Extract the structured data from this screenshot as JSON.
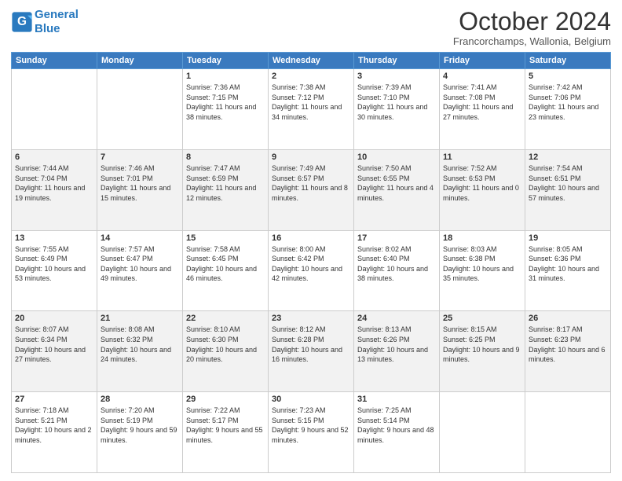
{
  "header": {
    "logo_line1": "General",
    "logo_line2": "Blue",
    "month": "October 2024",
    "location": "Francorchamps, Wallonia, Belgium"
  },
  "days_of_week": [
    "Sunday",
    "Monday",
    "Tuesday",
    "Wednesday",
    "Thursday",
    "Friday",
    "Saturday"
  ],
  "weeks": [
    [
      {
        "num": "",
        "detail": ""
      },
      {
        "num": "",
        "detail": ""
      },
      {
        "num": "1",
        "detail": "Sunrise: 7:36 AM\nSunset: 7:15 PM\nDaylight: 11 hours and 38 minutes."
      },
      {
        "num": "2",
        "detail": "Sunrise: 7:38 AM\nSunset: 7:12 PM\nDaylight: 11 hours and 34 minutes."
      },
      {
        "num": "3",
        "detail": "Sunrise: 7:39 AM\nSunset: 7:10 PM\nDaylight: 11 hours and 30 minutes."
      },
      {
        "num": "4",
        "detail": "Sunrise: 7:41 AM\nSunset: 7:08 PM\nDaylight: 11 hours and 27 minutes."
      },
      {
        "num": "5",
        "detail": "Sunrise: 7:42 AM\nSunset: 7:06 PM\nDaylight: 11 hours and 23 minutes."
      }
    ],
    [
      {
        "num": "6",
        "detail": "Sunrise: 7:44 AM\nSunset: 7:04 PM\nDaylight: 11 hours and 19 minutes."
      },
      {
        "num": "7",
        "detail": "Sunrise: 7:46 AM\nSunset: 7:01 PM\nDaylight: 11 hours and 15 minutes."
      },
      {
        "num": "8",
        "detail": "Sunrise: 7:47 AM\nSunset: 6:59 PM\nDaylight: 11 hours and 12 minutes."
      },
      {
        "num": "9",
        "detail": "Sunrise: 7:49 AM\nSunset: 6:57 PM\nDaylight: 11 hours and 8 minutes."
      },
      {
        "num": "10",
        "detail": "Sunrise: 7:50 AM\nSunset: 6:55 PM\nDaylight: 11 hours and 4 minutes."
      },
      {
        "num": "11",
        "detail": "Sunrise: 7:52 AM\nSunset: 6:53 PM\nDaylight: 11 hours and 0 minutes."
      },
      {
        "num": "12",
        "detail": "Sunrise: 7:54 AM\nSunset: 6:51 PM\nDaylight: 10 hours and 57 minutes."
      }
    ],
    [
      {
        "num": "13",
        "detail": "Sunrise: 7:55 AM\nSunset: 6:49 PM\nDaylight: 10 hours and 53 minutes."
      },
      {
        "num": "14",
        "detail": "Sunrise: 7:57 AM\nSunset: 6:47 PM\nDaylight: 10 hours and 49 minutes."
      },
      {
        "num": "15",
        "detail": "Sunrise: 7:58 AM\nSunset: 6:45 PM\nDaylight: 10 hours and 46 minutes."
      },
      {
        "num": "16",
        "detail": "Sunrise: 8:00 AM\nSunset: 6:42 PM\nDaylight: 10 hours and 42 minutes."
      },
      {
        "num": "17",
        "detail": "Sunrise: 8:02 AM\nSunset: 6:40 PM\nDaylight: 10 hours and 38 minutes."
      },
      {
        "num": "18",
        "detail": "Sunrise: 8:03 AM\nSunset: 6:38 PM\nDaylight: 10 hours and 35 minutes."
      },
      {
        "num": "19",
        "detail": "Sunrise: 8:05 AM\nSunset: 6:36 PM\nDaylight: 10 hours and 31 minutes."
      }
    ],
    [
      {
        "num": "20",
        "detail": "Sunrise: 8:07 AM\nSunset: 6:34 PM\nDaylight: 10 hours and 27 minutes."
      },
      {
        "num": "21",
        "detail": "Sunrise: 8:08 AM\nSunset: 6:32 PM\nDaylight: 10 hours and 24 minutes."
      },
      {
        "num": "22",
        "detail": "Sunrise: 8:10 AM\nSunset: 6:30 PM\nDaylight: 10 hours and 20 minutes."
      },
      {
        "num": "23",
        "detail": "Sunrise: 8:12 AM\nSunset: 6:28 PM\nDaylight: 10 hours and 16 minutes."
      },
      {
        "num": "24",
        "detail": "Sunrise: 8:13 AM\nSunset: 6:26 PM\nDaylight: 10 hours and 13 minutes."
      },
      {
        "num": "25",
        "detail": "Sunrise: 8:15 AM\nSunset: 6:25 PM\nDaylight: 10 hours and 9 minutes."
      },
      {
        "num": "26",
        "detail": "Sunrise: 8:17 AM\nSunset: 6:23 PM\nDaylight: 10 hours and 6 minutes."
      }
    ],
    [
      {
        "num": "27",
        "detail": "Sunrise: 7:18 AM\nSunset: 5:21 PM\nDaylight: 10 hours and 2 minutes."
      },
      {
        "num": "28",
        "detail": "Sunrise: 7:20 AM\nSunset: 5:19 PM\nDaylight: 9 hours and 59 minutes."
      },
      {
        "num": "29",
        "detail": "Sunrise: 7:22 AM\nSunset: 5:17 PM\nDaylight: 9 hours and 55 minutes."
      },
      {
        "num": "30",
        "detail": "Sunrise: 7:23 AM\nSunset: 5:15 PM\nDaylight: 9 hours and 52 minutes."
      },
      {
        "num": "31",
        "detail": "Sunrise: 7:25 AM\nSunset: 5:14 PM\nDaylight: 9 hours and 48 minutes."
      },
      {
        "num": "",
        "detail": ""
      },
      {
        "num": "",
        "detail": ""
      }
    ]
  ]
}
